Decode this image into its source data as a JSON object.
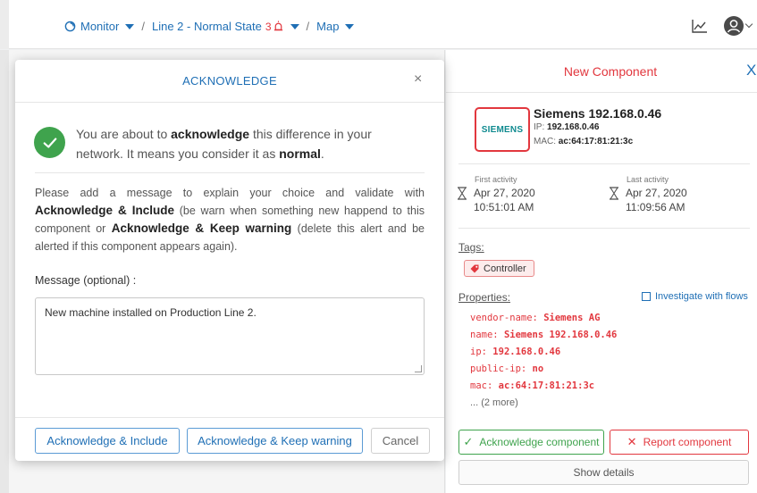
{
  "breadcrumb": {
    "monitor": "Monitor",
    "line": "Line 2 - Normal State",
    "alert_count": "3",
    "view": "Map"
  },
  "panel": {
    "title": "New Component",
    "close": "X",
    "vendor_logo": "SIEMENS",
    "component_name": "Siemens 192.168.0.46",
    "ip_label": "IP:",
    "ip_value": "192.168.0.46",
    "mac_label": "MAC:",
    "mac_value": "ac:64:17:81:21:3c",
    "first_activity_label": "First activity",
    "first_activity_date": "Apr 27, 2020",
    "first_activity_time": "10:51:01 AM",
    "last_activity_label": "Last activity",
    "last_activity_date": "Apr 27, 2020",
    "last_activity_time": "11:09:56 AM",
    "tags_label": "Tags:",
    "tag": "Controller",
    "properties_label": "Properties:",
    "investigate": "Investigate with flows",
    "properties": [
      {
        "key": "vendor-name:",
        "value": "Siemens AG"
      },
      {
        "key": "name:",
        "value": "Siemens 192.168.0.46"
      },
      {
        "key": "ip:",
        "value": "192.168.0.46"
      },
      {
        "key": "public-ip:",
        "value": "no"
      },
      {
        "key": "mac:",
        "value": "ac:64:17:81:21:3c"
      }
    ],
    "more": "... (2 more)",
    "ack_button": "Acknowledge component",
    "report_button": "Report component",
    "details_button": "Show details"
  },
  "modal": {
    "title": "ACKNOWLEDGE",
    "close": "×",
    "intro_1": "You are about to ",
    "intro_bold_1": "acknowledge",
    "intro_2": " this difference in your network. It means you consider it as ",
    "intro_bold_2": "normal",
    "intro_3": ".",
    "desc_1": "Please add a message to explain your choice and validate with ",
    "desc_bold_1": "Acknowledge & Include",
    "desc_2": " (be warn when something new happend to this component or ",
    "desc_bold_2": "Acknowledge & Keep warning",
    "desc_3": " (delete this alert and be alerted if this component appears again).",
    "message_label": "Message (optional) :",
    "message_value": "New machine installed on Production Line 2.",
    "btn_include": "Acknowledge & Include",
    "btn_keep": "Acknowledge & Keep warning",
    "btn_cancel": "Cancel"
  },
  "colors": {
    "accent_blue": "#1f6fb5",
    "alert_red": "#e2373e",
    "ok_green": "#3fa34d"
  }
}
